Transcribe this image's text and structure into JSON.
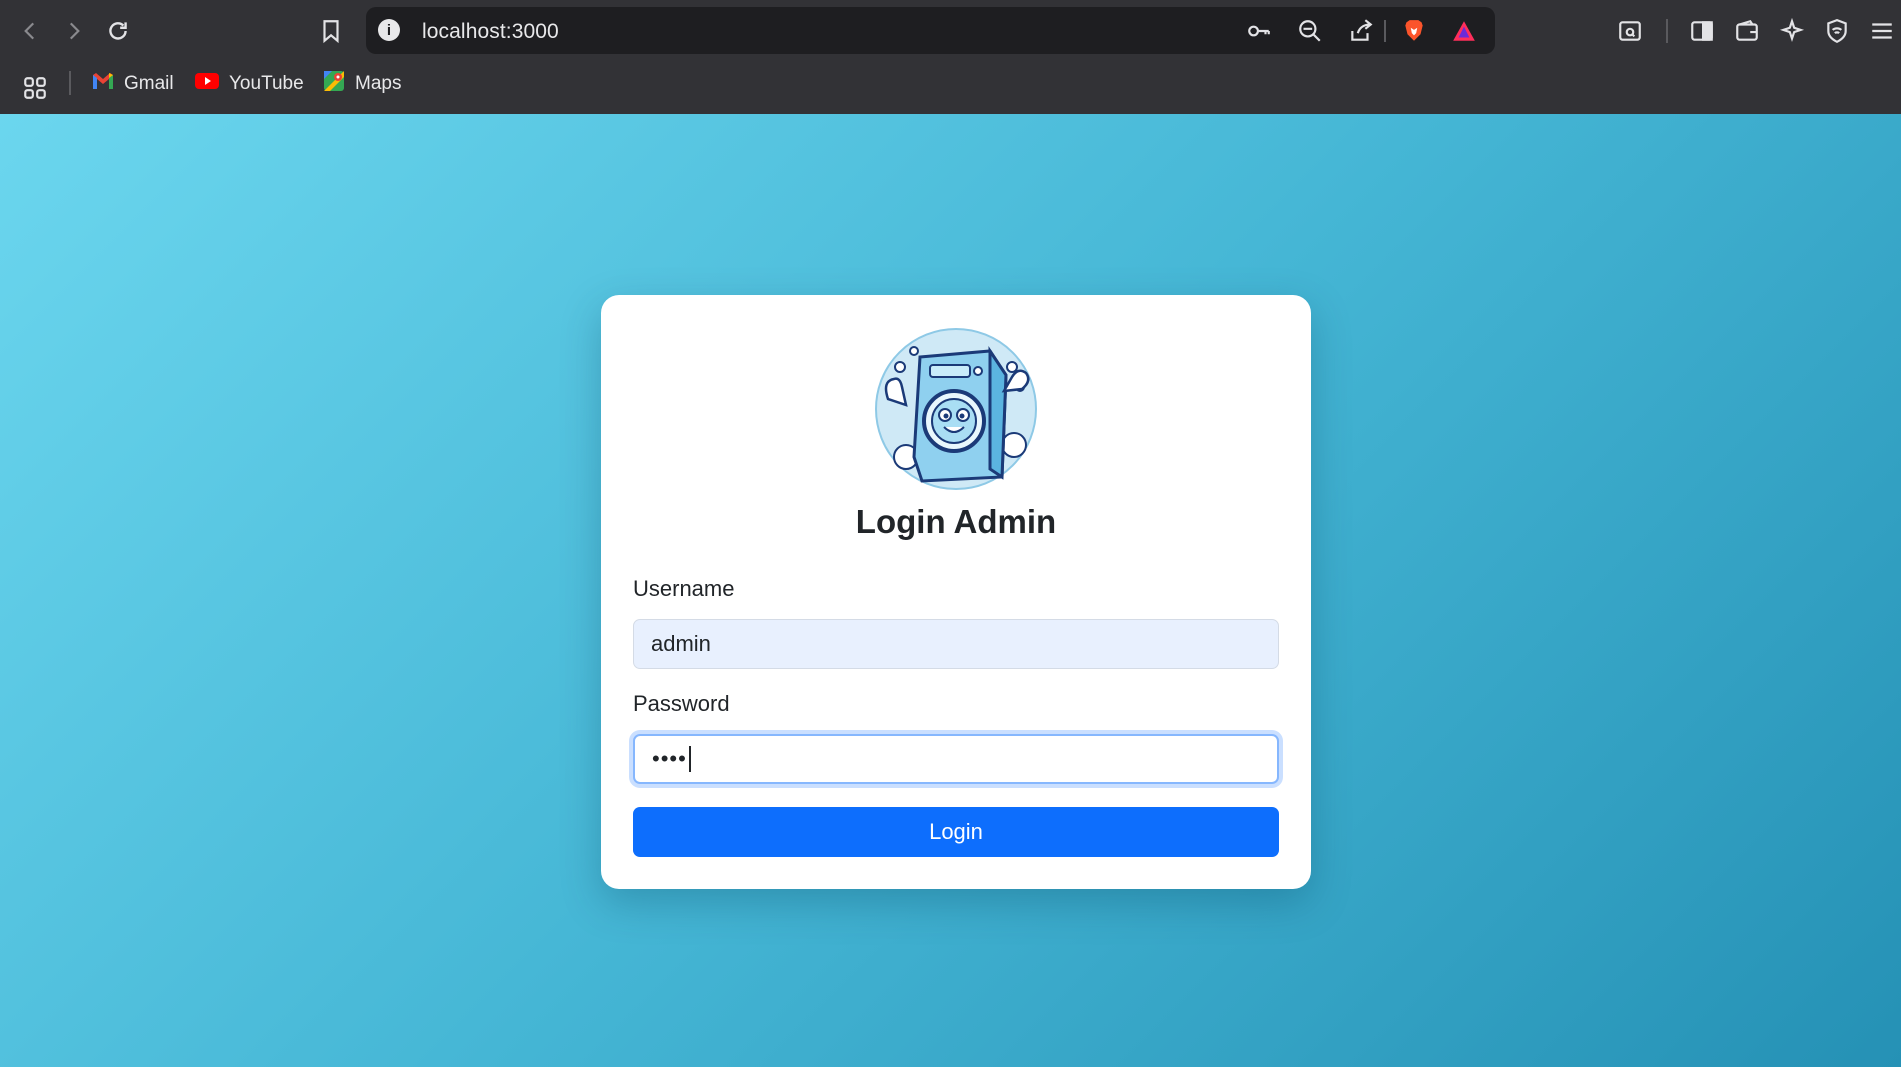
{
  "browser": {
    "url": "localhost:3000",
    "bookmarks": [
      {
        "label": "Gmail",
        "icon": "gmail-icon"
      },
      {
        "label": "YouTube",
        "icon": "youtube-icon"
      },
      {
        "label": "Maps",
        "icon": "maps-icon"
      }
    ]
  },
  "login": {
    "title": "Login Admin",
    "username_label": "Username",
    "username_value": "admin",
    "password_label": "Password",
    "password_value": "••••",
    "button_label": "Login"
  },
  "colors": {
    "primary": "#0d6efd",
    "page_gradient_start": "#6bd6ee",
    "page_gradient_end": "#2591b5"
  }
}
